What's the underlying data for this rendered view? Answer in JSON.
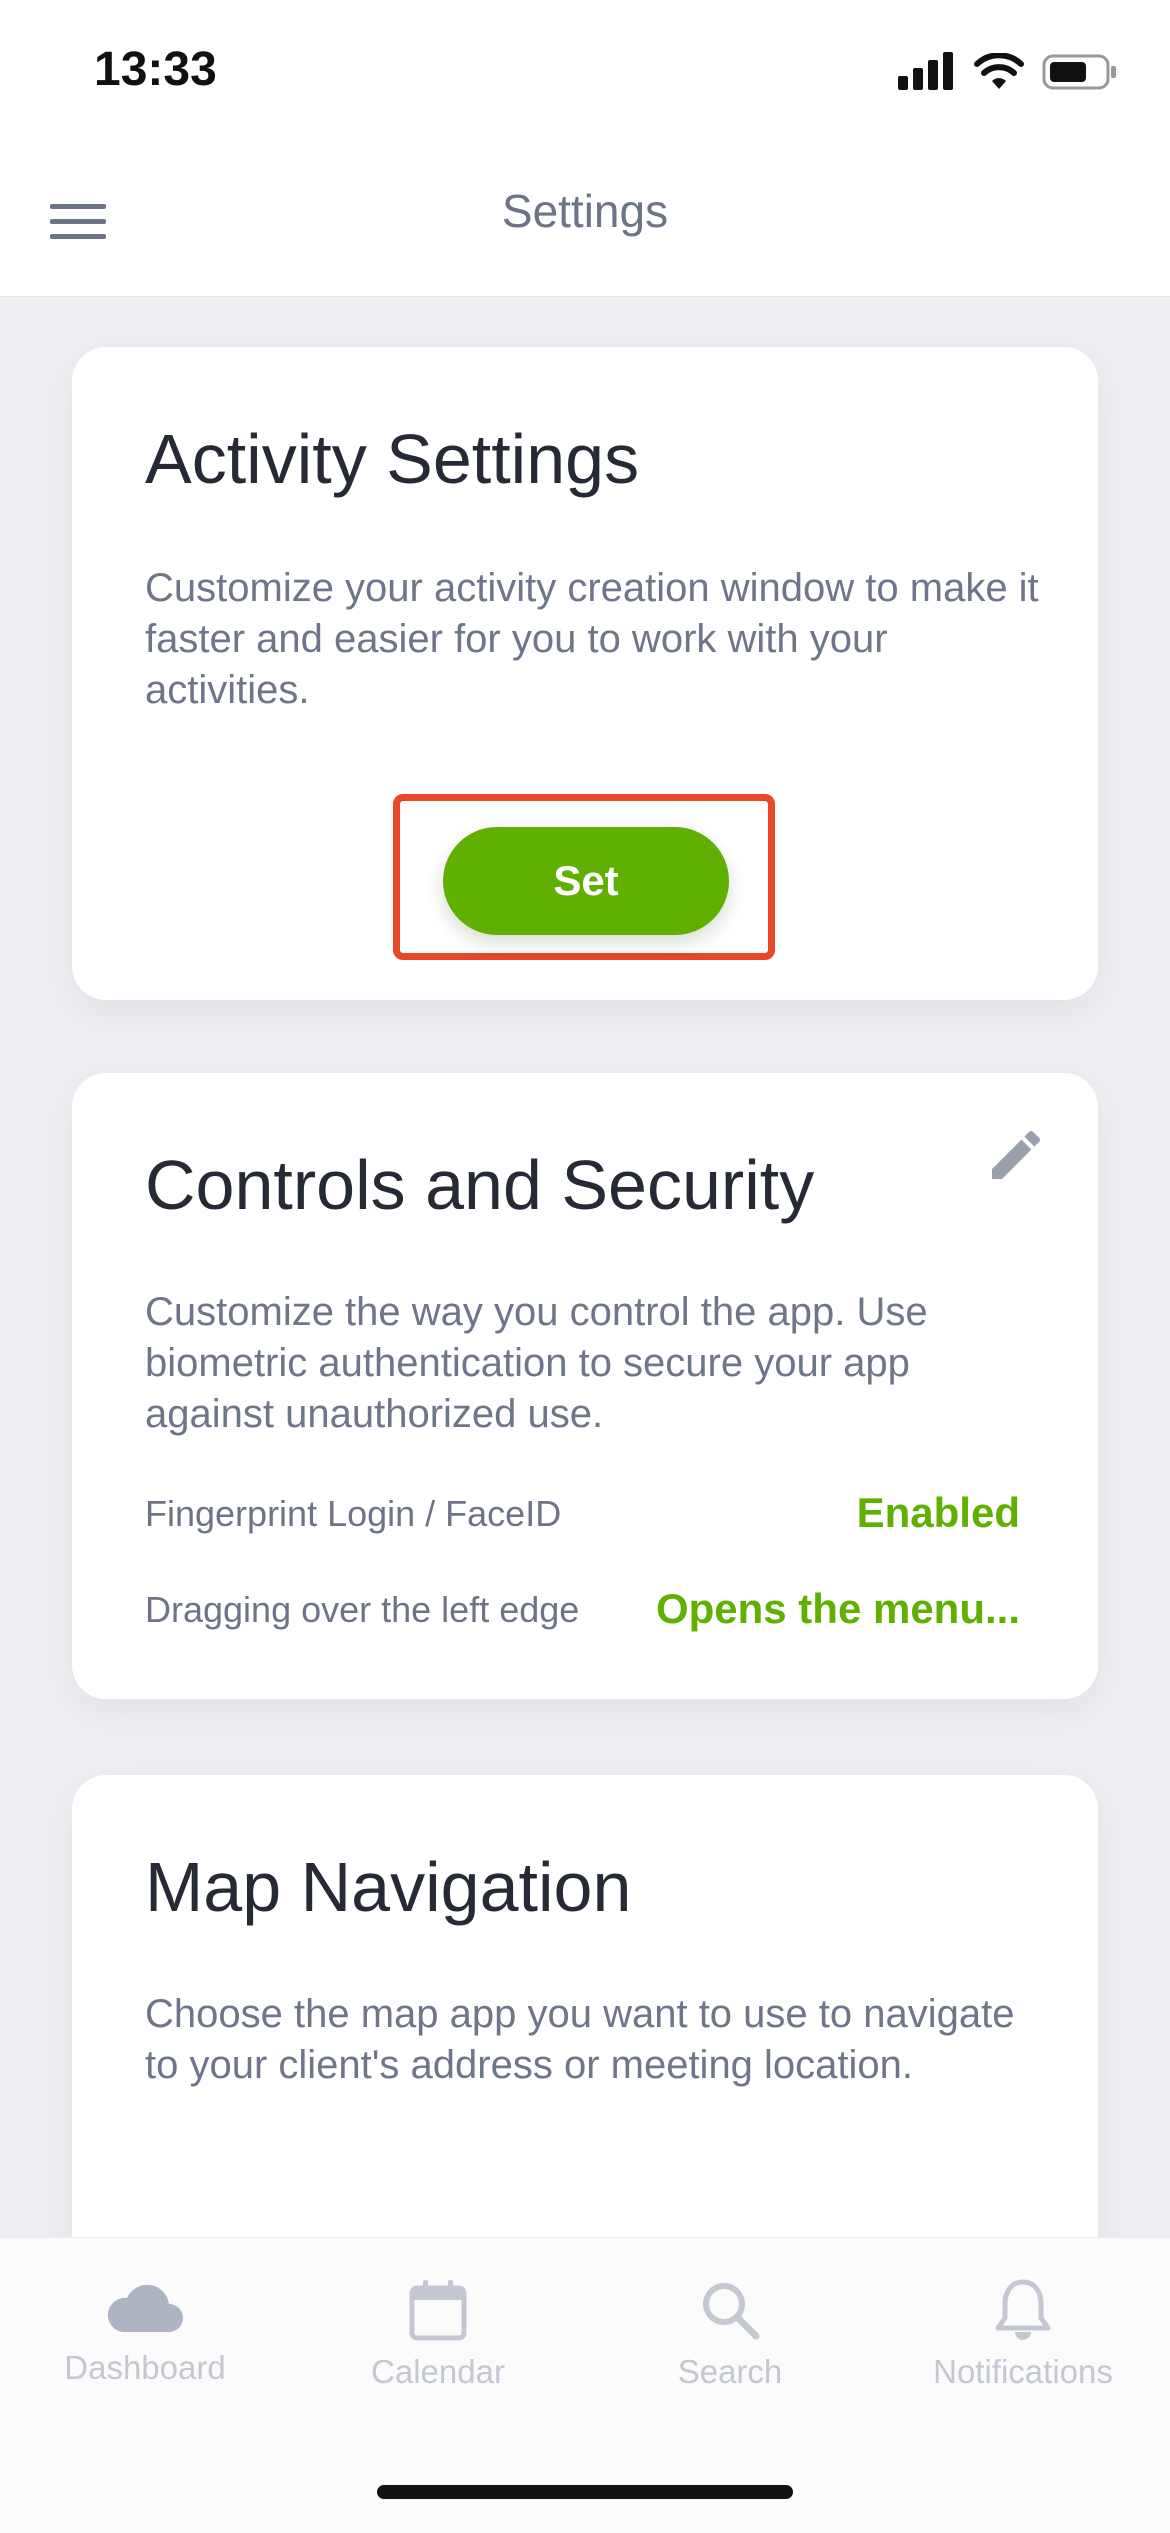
{
  "status_bar": {
    "time": "13:33"
  },
  "header": {
    "title": "Settings"
  },
  "cards": {
    "activity": {
      "title": "Activity Settings",
      "description": "Customize your activity creation window to make it faster and easier for you to work with your activities.",
      "button_label": "Set"
    },
    "controls": {
      "title": "Controls and Security",
      "description": "Customize the way you control the app. Use biometric authentication to secure your app against unauthorized use.",
      "rows": [
        {
          "label": "Fingerprint Login / FaceID",
          "value": "Enabled"
        },
        {
          "label": "Dragging over the left edge",
          "value": "Opens the menu..."
        }
      ]
    },
    "map": {
      "title": "Map Navigation",
      "description": "Choose the map app you want to use to navigate to your client's address or meeting location."
    }
  },
  "tabbar": {
    "items": [
      {
        "label": "Dashboard",
        "icon": "cloud-icon"
      },
      {
        "label": "Calendar",
        "icon": "calendar-icon"
      },
      {
        "label": "Search",
        "icon": "search-icon"
      },
      {
        "label": "Notifications",
        "icon": "bell-icon"
      }
    ]
  },
  "colors": {
    "accent": "#5fb000",
    "highlight": "#e84827",
    "tab_inactive": "#c4c8d2"
  }
}
